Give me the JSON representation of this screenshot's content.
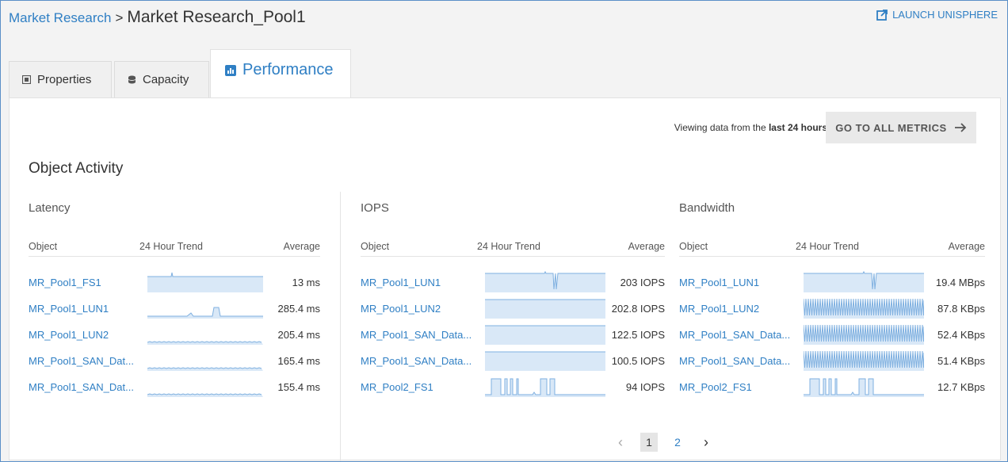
{
  "header": {
    "breadcrumb_parent": "Market Research",
    "breadcrumb_separator": ">",
    "title": "Market Research_Pool1",
    "launch_label": "LAUNCH UNISPHERE"
  },
  "tabs": [
    {
      "label": "Properties"
    },
    {
      "label": "Capacity"
    },
    {
      "label": "Performance"
    }
  ],
  "toolbar": {
    "viewing_prefix": "Viewing data from the",
    "viewing_range": "last 24 hours",
    "all_metrics_label": "GO TO ALL METRICS"
  },
  "object_activity": {
    "title": "Object Activity",
    "latency": {
      "title": "Latency",
      "col_object": "Object",
      "col_trend": "24 Hour Trend",
      "col_average": "Average",
      "rows": [
        {
          "object": "MR_Pool1_FS1",
          "average": "13 ms",
          "trend": "flat-spike"
        },
        {
          "object": "MR_Pool1_LUN1",
          "average": "285.4 ms",
          "trend": "low-bumps"
        },
        {
          "object": "MR_Pool1_LUN2",
          "average": "205.4 ms",
          "trend": "low-noise"
        },
        {
          "object": "MR_Pool1_SAN_Dat...",
          "average": "165.4 ms",
          "trend": "low-noise"
        },
        {
          "object": "MR_Pool1_SAN_Dat...",
          "average": "155.4 ms",
          "trend": "low-noise"
        }
      ]
    },
    "iops": {
      "title": "IOPS",
      "col_object": "Object",
      "col_trend": "24 Hour Trend",
      "col_average": "Average",
      "rows": [
        {
          "object": "MR_Pool1_LUN1",
          "average": "203 IOPS",
          "trend": "high-notch"
        },
        {
          "object": "MR_Pool1_LUN2",
          "average": "202.8 IOPS",
          "trend": "high-flat"
        },
        {
          "object": "MR_Pool1_SAN_Data...",
          "average": "122.5 IOPS",
          "trend": "high-flat"
        },
        {
          "object": "MR_Pool1_SAN_Data...",
          "average": "100.5 IOPS",
          "trend": "high-flat"
        },
        {
          "object": "MR_Pool2_FS1",
          "average": "94 IOPS",
          "trend": "pulses"
        }
      ]
    },
    "bandwidth": {
      "title": "Bandwidth",
      "col_object": "Object",
      "col_trend": "24 Hour Trend",
      "col_average": "Average",
      "rows": [
        {
          "object": "MR_Pool1_LUN1",
          "average": "19.4 MBps",
          "trend": "high-notch"
        },
        {
          "object": "MR_Pool1_LUN2",
          "average": "87.8 KBps",
          "trend": "dense"
        },
        {
          "object": "MR_Pool1_SAN_Data...",
          "average": "52.4 KBps",
          "trend": "dense"
        },
        {
          "object": "MR_Pool1_SAN_Data...",
          "average": "51.4 KBps",
          "trend": "dense"
        },
        {
          "object": "MR_Pool2_FS1",
          "average": "12.7 KBps",
          "trend": "pulses"
        }
      ]
    }
  },
  "pagination": {
    "prev": "‹",
    "pages": [
      "1",
      "2"
    ],
    "current_page": "1",
    "next": "›"
  },
  "colors": {
    "accent": "#2f7fc4",
    "spark_fill": "#d9e8f7",
    "spark_line": "#7fb0e0"
  }
}
